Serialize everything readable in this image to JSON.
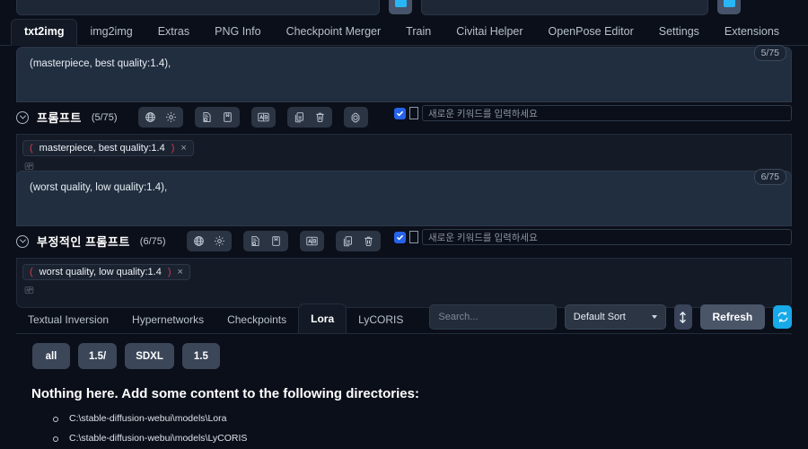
{
  "top_row": {
    "buttons": [
      "blue-icon-button-1",
      "blue-icon-button-2"
    ]
  },
  "main_tabs": [
    {
      "label": "txt2img",
      "active": true
    },
    {
      "label": "img2img",
      "active": false
    },
    {
      "label": "Extras",
      "active": false
    },
    {
      "label": "PNG Info",
      "active": false
    },
    {
      "label": "Checkpoint Merger",
      "active": false
    },
    {
      "label": "Train",
      "active": false
    },
    {
      "label": "Civitai Helper",
      "active": false
    },
    {
      "label": "OpenPose Editor",
      "active": false
    },
    {
      "label": "Settings",
      "active": false
    },
    {
      "label": "Extensions",
      "active": false
    }
  ],
  "prompt": {
    "textarea_value": "(masterpiece, best quality:1.4),",
    "token_counter": "5/75",
    "title": "프롬프트",
    "count": "(5/75)",
    "keyword_placeholder": "새로운 키워드를 입력하세요",
    "checkbox_checked": true,
    "icons": [
      [
        "globe-icon",
        "gear-icon"
      ],
      [
        "document-search-icon",
        "bookmark-icon"
      ],
      [
        "translate-ab-icon"
      ],
      [
        "copy-icon",
        "trash-icon"
      ],
      [
        "openai-spiral-icon"
      ]
    ],
    "chip": {
      "open_paren": "(",
      "text": "masterpiece, best quality:1.4",
      "close_paren": ")",
      "remove": "×"
    }
  },
  "negative_prompt": {
    "textarea_value": "(worst quality, low quality:1.4),",
    "token_counter": "6/75",
    "title": "부정적인 프롬프트",
    "count": "(6/75)",
    "keyword_placeholder": "새로운 키워드를 입력하세요",
    "checkbox_checked": true,
    "icons": [
      [
        "globe-icon",
        "gear-icon"
      ],
      [
        "document-search-icon",
        "bookmark-icon"
      ],
      [
        "translate-ab-icon"
      ],
      [
        "copy-icon",
        "trash-icon"
      ]
    ],
    "chip": {
      "open_paren": "(",
      "text": "worst quality, low quality:1.4",
      "close_paren": ")",
      "remove": "×"
    }
  },
  "extra_networks": {
    "tabs": [
      {
        "label": "Textual Inversion",
        "active": false
      },
      {
        "label": "Hypernetworks",
        "active": false
      },
      {
        "label": "Checkpoints",
        "active": false
      },
      {
        "label": "Lora",
        "active": true
      },
      {
        "label": "LyCORIS",
        "active": false
      }
    ],
    "search_placeholder": "Search...",
    "sort_value": "Default Sort",
    "sort_direction_icon": "up-down-arrow-icon",
    "refresh_label": "Refresh",
    "sync_icon": "sync-refresh-icon",
    "filters": [
      "all",
      "1.5/",
      "SDXL",
      "1.5"
    ],
    "empty_heading": "Nothing here. Add some content to the following directories:",
    "directories": [
      "C:\\stable-diffusion-webui\\models\\Lora",
      "C:\\stable-diffusion-webui\\models\\LyCORIS"
    ]
  },
  "colors": {
    "page_bg": "#0b0f19",
    "textarea_bg": "#212e3f",
    "accent_blue": "#2563eb",
    "sync_cyan": "#18a9e8",
    "chip_paren_red": "#d7384f",
    "button_gray": "#4a5568"
  }
}
